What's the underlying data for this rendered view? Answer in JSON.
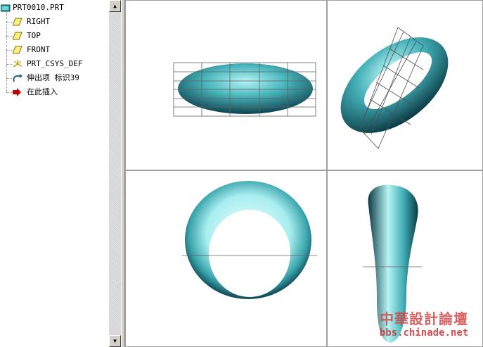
{
  "model_tree": {
    "items": [
      {
        "label": "PRT0010.PRT",
        "icon": "part-icon"
      },
      {
        "label": "RIGHT",
        "icon": "datum-plane-icon"
      },
      {
        "label": "TOP",
        "icon": "datum-plane-icon"
      },
      {
        "label": "FRONT",
        "icon": "datum-plane-icon"
      },
      {
        "label": "PRT_CSYS_DEF",
        "icon": "coordinate-system-icon"
      },
      {
        "label": "伸出项 标识39",
        "icon": "protrusion-icon"
      },
      {
        "label": "在此插入",
        "icon": "insert-here-arrow-icon"
      }
    ]
  },
  "scrollbar": {
    "up_glyph": "▲",
    "down_glyph": "▼"
  },
  "viewports": [
    {
      "name": "top-view"
    },
    {
      "name": "isometric-view"
    },
    {
      "name": "front-view"
    },
    {
      "name": "side-view"
    }
  ],
  "watermark": {
    "chinese": "中華設計論壇",
    "url": "bbs.chinade.net"
  },
  "colors": {
    "model_teal": "#3aa8b0",
    "watermark_red": "#cc3030",
    "icon_yellow": "#e8d800"
  }
}
